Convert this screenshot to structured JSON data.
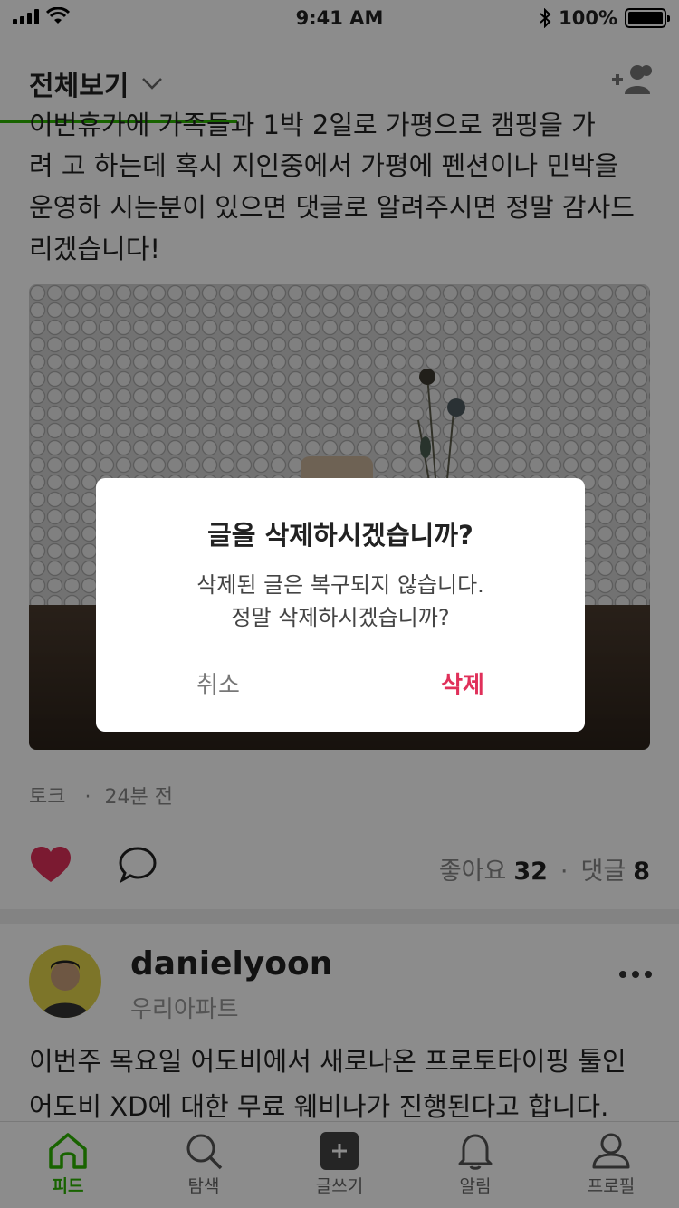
{
  "status_bar": {
    "time": "9:41 AM",
    "battery": "100%"
  },
  "header": {
    "title": "전체보기"
  },
  "post": {
    "text_lines": [
      "이번휴가에 가족들과 1박 2일로 가평으로 캠핑을 가",
      "려 고 하는데 혹시 지인중에서 가평에 펜션이나 민박을",
      "운영하 시는분이 있으면 댓글로 알려주시면 정말 감사드",
      "리겠습니다!"
    ],
    "category": "토크",
    "time_ago": "24분 전",
    "likes_label": "좋아요",
    "likes_count": "32",
    "comments_label": "댓글",
    "comments_count": "8",
    "separator": "·"
  },
  "post2": {
    "username": "danielyoon",
    "group": "우리아파트",
    "text_lines": [
      "이번주 목요일 어도비에서 새로나온 프로토타이핑 툴인",
      "어도비 XD에 대한 무료 웨비나가 진행된다고 합니다."
    ]
  },
  "tabbar": {
    "items": [
      {
        "label": "피드",
        "icon": "home-icon",
        "active": true
      },
      {
        "label": "탐색",
        "icon": "search-icon",
        "active": false
      },
      {
        "label": "글쓰기",
        "icon": "write-icon",
        "active": false
      },
      {
        "label": "알림",
        "icon": "bell-icon",
        "active": false
      },
      {
        "label": "프로필",
        "icon": "profile-icon",
        "active": false
      }
    ]
  },
  "dialog": {
    "title": "글을 삭제하시겠습니까?",
    "message": "삭제된 글은 복구되지 않습니다.\n정말 삭제하시겠습니까?",
    "cancel_label": "취소",
    "delete_label": "삭제"
  },
  "colors": {
    "accent": "#2db400",
    "danger": "#e0305a",
    "like": "#e0305a"
  }
}
